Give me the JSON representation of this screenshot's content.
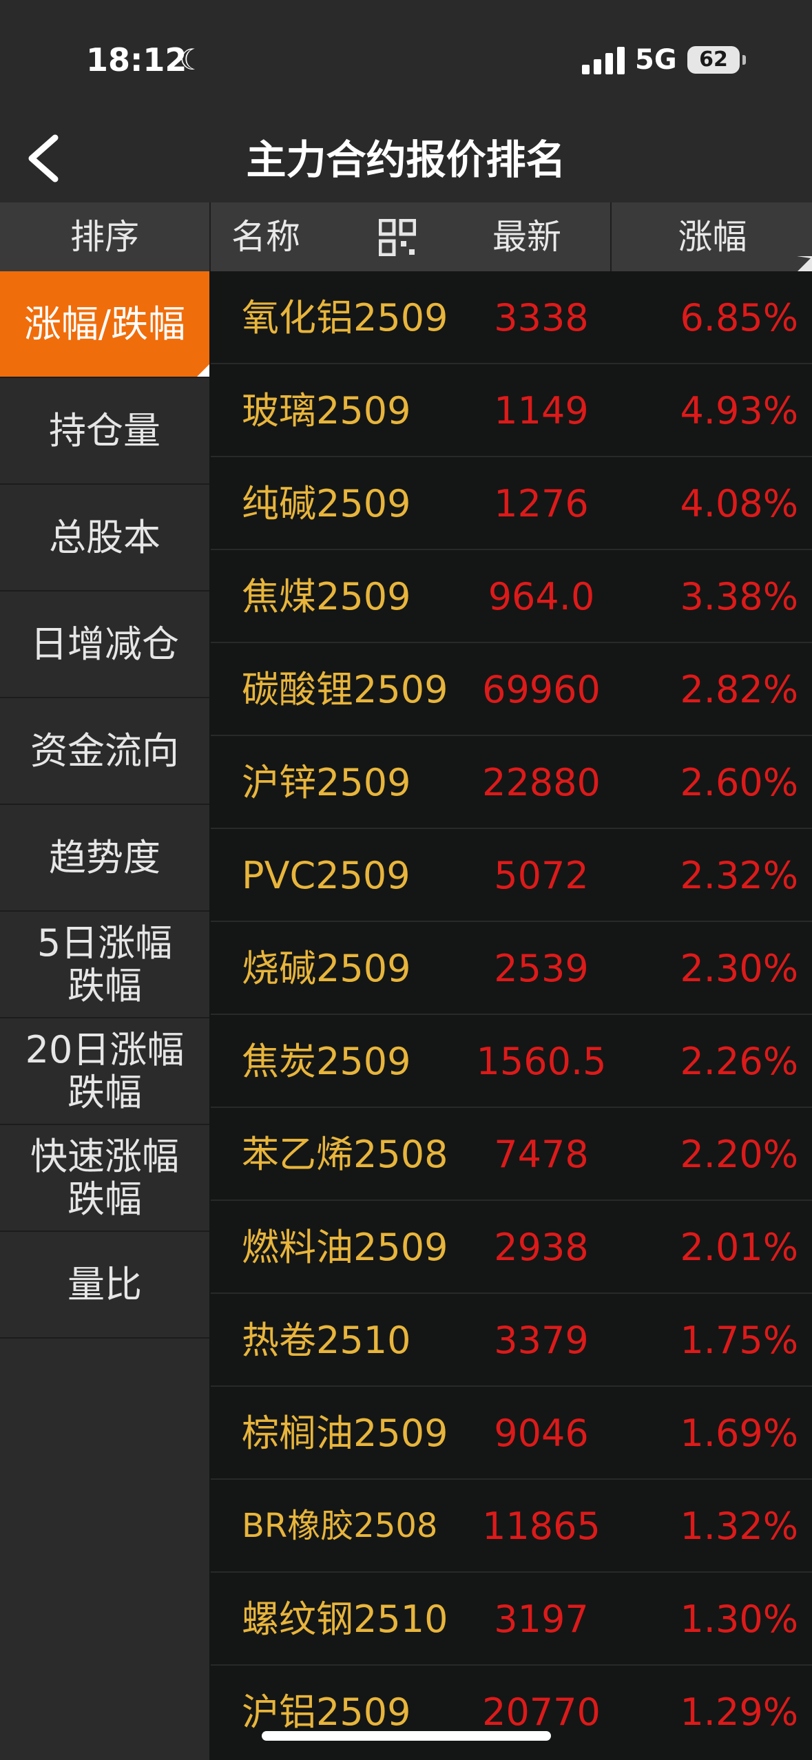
{
  "status_bar": {
    "time": "18:12",
    "network": "5G",
    "battery": "62"
  },
  "header": {
    "title": "主力合约报价排名"
  },
  "columns": {
    "sort": "排序",
    "name": "名称",
    "latest": "最新",
    "change": "涨幅"
  },
  "sidebar": {
    "items": [
      {
        "label": "涨幅/跌幅",
        "active": true
      },
      {
        "label": "持仓量"
      },
      {
        "label": "总股本"
      },
      {
        "label": "日增减仓"
      },
      {
        "label": "资金流向"
      },
      {
        "label": "趋势度"
      },
      {
        "label": "5日涨幅跌幅"
      },
      {
        "label": "20日涨幅跌幅"
      },
      {
        "label": "快速涨幅跌幅"
      },
      {
        "label": "量比"
      }
    ]
  },
  "rows": [
    {
      "name": "氧化铝2509",
      "price": "3338",
      "change": "6.85%"
    },
    {
      "name": "玻璃2509",
      "price": "1149",
      "change": "4.93%"
    },
    {
      "name": "纯碱2509",
      "price": "1276",
      "change": "4.08%"
    },
    {
      "name": "焦煤2509",
      "price": "964.0",
      "change": "3.38%"
    },
    {
      "name": "碳酸锂2509",
      "price": "69960",
      "change": "2.82%"
    },
    {
      "name": "沪锌2509",
      "price": "22880",
      "change": "2.60%"
    },
    {
      "name": "PVC2509",
      "price": "5072",
      "change": "2.32%"
    },
    {
      "name": "烧碱2509",
      "price": "2539",
      "change": "2.30%"
    },
    {
      "name": "焦炭2509",
      "price": "1560.5",
      "change": "2.26%"
    },
    {
      "name": "苯乙烯2508",
      "price": "7478",
      "change": "2.20%"
    },
    {
      "name": "燃料油2509",
      "price": "2938",
      "change": "2.01%"
    },
    {
      "name": "热卷2510",
      "price": "3379",
      "change": "1.75%"
    },
    {
      "name": "棕榈油2509",
      "price": "9046",
      "change": "1.69%"
    },
    {
      "name": "BR橡胶2508",
      "price": "11865",
      "change": "1.32%"
    },
    {
      "name": "螺纹钢2510",
      "price": "3197",
      "change": "1.30%"
    },
    {
      "name": "沪铝2509",
      "price": "20770",
      "change": "1.29%"
    }
  ],
  "colors": {
    "accent": "#f06d0b",
    "name_text": "#e8b53c",
    "up": "#dd1a1a"
  }
}
